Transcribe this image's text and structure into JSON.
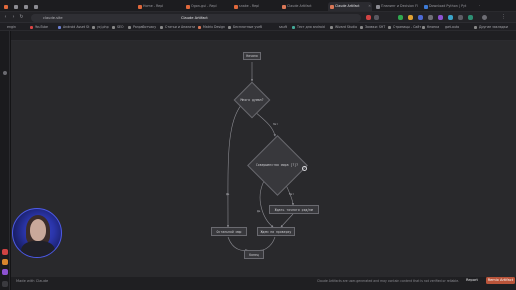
{
  "browser": {
    "tabs": [
      {
        "label": "",
        "active": false
      },
      {
        "label": "",
        "active": false
      },
      {
        "label": "",
        "active": false
      },
      {
        "label": "",
        "active": false
      },
      {
        "label": "Home - Repl",
        "active": false
      },
      {
        "label": "Ogon-gui - Repl",
        "active": false
      },
      {
        "label": "snake - Repl",
        "active": false
      },
      {
        "label": "Claude Artifact",
        "active": false
      },
      {
        "label": "Claude Artifact",
        "active": true
      },
      {
        "label": "Планинг и Decision Fl",
        "active": false
      },
      {
        "label": "Download Python | Pyt",
        "active": false
      }
    ],
    "address": {
      "url": "claude.site",
      "title": "Claude Artifact"
    },
    "bookmarks": [
      "engin",
      "YouTube",
      "Android Asset St",
      "ycj.php",
      "SEO",
      "Разработчику",
      "Статьи и Аналити",
      "Matrix Design",
      "Бесплатные учеб",
      "sauft",
      "Тест для android",
      "Wizard Studio",
      "Заявки: SHT",
      "Страницы - Сайт",
      "Кнопка",
      "gwt-auto",
      "Другие закладки"
    ]
  },
  "flowchart": {
    "nodes": {
      "start": "Начало",
      "decision1": "Много думал?",
      "decision2": "Совершенство мира [?]?",
      "process_left": "Остальной мир",
      "process_right": "Ждать точного ряд/ме",
      "process_mid": "Ждем на проверку",
      "end": "Конец"
    },
    "edge_labels": {
      "yes1": "Нет",
      "no1": "Да",
      "yes2": "Да",
      "no2": "Нет"
    }
  },
  "footer": {
    "made_with": "Made with Claude",
    "disclaimer": "Claude Artifacts are user-generated and may contain content that is not verified or reliable.",
    "report_label": "Report",
    "remix_label": "Remix Artifact"
  },
  "colors": {
    "canvas_bg": "#29292c",
    "node_bg": "#38383c",
    "node_border": "#6a6a70",
    "accent": "#b9543a"
  }
}
